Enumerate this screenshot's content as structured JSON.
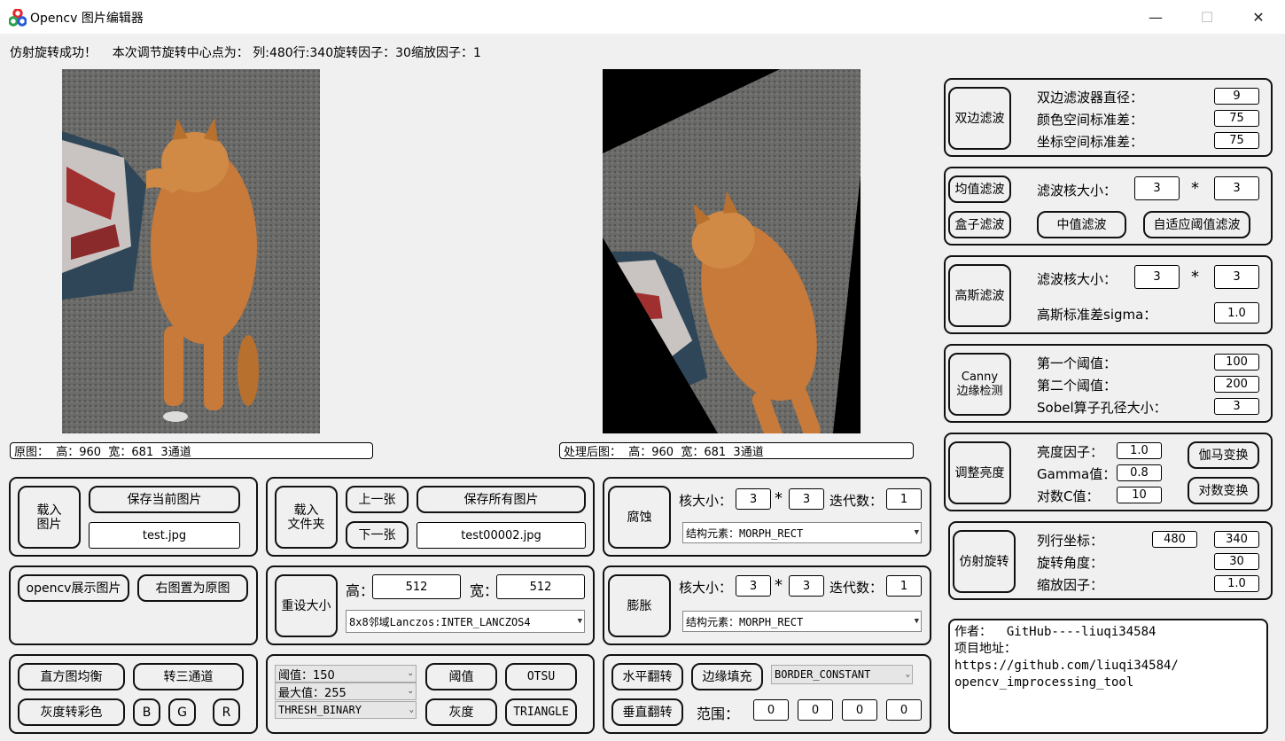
{
  "window": {
    "title": "Opencv 图片编辑器",
    "minimize": "—",
    "maximize": "☐",
    "close": "✕"
  },
  "status_text": "仿射旋转成功！    本次调节旋转中心点为： 列:480行:340旋转因子：30缩放因子：1",
  "original_info": "原图：  高：960  宽：681  3通道",
  "processed_info": "处理后图：  高：960  宽：681  3通道",
  "bilateral": {
    "button": "双边滤波",
    "diameter_label": "双边滤波器直径：",
    "diameter": "9",
    "color_sigma_label": "颜色空间标准差：",
    "color_sigma": "75",
    "space_sigma_label": "坐标空间标准差：",
    "space_sigma": "75"
  },
  "mean_filter": {
    "button": "均值滤波",
    "box_button": "盒子滤波",
    "kernel_label": "滤波核大小：",
    "kw": "3",
    "times": "*",
    "kh": "3",
    "median_button": "中值滤波",
    "adaptive_button": "自适应阈值滤波"
  },
  "gaussian": {
    "button": "高斯滤波",
    "kernel_label": "滤波核大小：",
    "kw": "3",
    "times": "*",
    "kh": "3",
    "sigma_label": "高斯标准差sigma：",
    "sigma": "1.0"
  },
  "canny": {
    "button": "Canny\n边缘检测",
    "t1_label": "第一个阈值：",
    "t1": "100",
    "t2_label": "第二个阈值：",
    "t2": "200",
    "sobel_label": "Sobel算子孔径大小：",
    "sobel": "3"
  },
  "brightness": {
    "button": "调整亮度",
    "bright_label": "亮度因子：",
    "bright": "1.0",
    "gamma_label": "Gamma值：",
    "gamma": "0.8",
    "logc_label": "对数C值：",
    "logc": "10",
    "gamma_button": "伽马变换",
    "log_button": "对数变换"
  },
  "affine": {
    "button": "仿射旋转",
    "pos_label": "列行坐标：",
    "col": "480",
    "row": "340",
    "angle_label": "旋转角度：",
    "angle": "30",
    "scale_label": "缩放因子：",
    "scale": "1.0"
  },
  "about_text": "作者：  GitHub----liuqi34584\n项目地址：\nhttps://github.com/liuqi34584/\nopencv_improcessing_tool",
  "load_image": {
    "button": "载入\n图片",
    "save_button": "保存当前图片",
    "filename": "test.jpg"
  },
  "load_folder": {
    "button": "载入\n文件夹",
    "prev_button": "上一张",
    "next_button": "下一张",
    "save_all_button": "保存所有图片",
    "filename": "test00002.jpg"
  },
  "erode": {
    "button": "腐蚀",
    "kernel_label": "核大小：",
    "kw": "3",
    "times": "*",
    "kh": "3",
    "iter_label": "迭代数：",
    "iter": "1",
    "element": "结构元素：MORPH_RECT"
  },
  "dilate": {
    "button": "膨胀",
    "kernel_label": "核大小：",
    "kw": "3",
    "times": "*",
    "kh": "3",
    "iter_label": "迭代数：",
    "iter": "1",
    "element": "结构元素：MORPH_RECT"
  },
  "display": {
    "show_button": "opencv展示图片",
    "reset_button": "右图置为原图"
  },
  "resize": {
    "button": "重设大小",
    "h_label": "高：",
    "h": "512",
    "w_label": "宽：",
    "w": "512",
    "interp": "8x8邻域Lanczos:INTER_LANCZOS4"
  },
  "hist": {
    "equalize_button": "直方图均衡",
    "to3_button": "转三通道",
    "gray2color_button": "灰度转彩色",
    "b_button": "B",
    "g_button": "G",
    "r_button": "R"
  },
  "threshold": {
    "thresh_combo": "阈值：150",
    "max_combo": "最大值：255",
    "type_combo": "THRESH_BINARY",
    "thresh_button": "阈值",
    "otsu_button": "OTSU",
    "gray_button": "灰度",
    "triangle_button": "TRIANGLE"
  },
  "flip": {
    "hflip_button": "水平翻转",
    "border_button": "边缘填充",
    "border_combo": "BORDER_CONSTANT",
    "vflip_button": "垂直翻转",
    "range_label": "范围：",
    "r1": "0",
    "r2": "0",
    "r3": "0",
    "r4": "0"
  }
}
